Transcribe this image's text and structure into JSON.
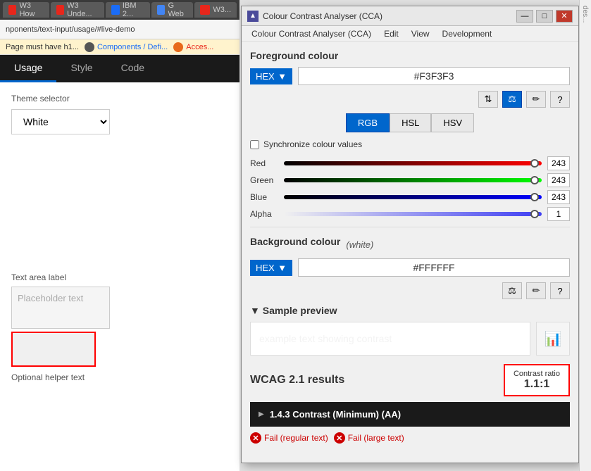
{
  "browser": {
    "tabs": [
      {
        "label": "W3 How",
        "active": false,
        "color": "#e8261b"
      },
      {
        "label": "W3 Unde...",
        "active": false,
        "color": "#e8261b"
      },
      {
        "label": "IBM 2...",
        "active": false,
        "color": "#1a6cf7"
      },
      {
        "label": "G Web",
        "active": false,
        "color": "#4285f4"
      },
      {
        "label": "W3...",
        "active": false,
        "color": "#e8261b"
      }
    ],
    "address": "nponents/text-input/usage/#live-demo",
    "alert": "Page must have h1...",
    "breadcrumb1": "Components / Defi...",
    "breadcrumb2": "Acces..."
  },
  "content_tabs": [
    {
      "label": "Usage",
      "active": true
    },
    {
      "label": "Style",
      "active": false
    },
    {
      "label": "Code",
      "active": false
    }
  ],
  "form": {
    "theme_label": "Theme selector",
    "theme_value": "White",
    "textarea_label": "Text area label",
    "placeholder": "Placeholder text",
    "helper": "Optional helper text"
  },
  "cca": {
    "title": "Colour Contrast Analyser (CCA)",
    "menu_items": [
      "Colour Contrast Analyser (CCA)",
      "Edit",
      "View",
      "Development"
    ],
    "fg_section": "Foreground colour",
    "fg_format": "HEX",
    "fg_value": "#F3F3F3",
    "color_modes": [
      "RGB",
      "HSL",
      "HSV"
    ],
    "active_mode": "RGB",
    "sync_label": "Synchronize colour values",
    "sliders": [
      {
        "label": "Red",
        "value": "243"
      },
      {
        "label": "Green",
        "value": "243"
      },
      {
        "label": "Blue",
        "value": "243"
      },
      {
        "label": "Alpha",
        "value": "1"
      }
    ],
    "bg_section": "Background colour",
    "bg_format": "HEX",
    "bg_value": "#FFFFFF",
    "bg_note": "(white)",
    "sample_preview": "▼ Sample preview",
    "sample_text": "example text showing contrast",
    "wcag_title": "WCAG 2.1 results",
    "contrast_ratio_label": "Contrast ratio",
    "contrast_ratio_value": "1.1:1",
    "wcag_item": "1.4.3 Contrast (Minimum) (AA)",
    "fail_regular": "Fail (regular text)",
    "fail_large": "Fail (large text)",
    "icons": {
      "sort": "⇅",
      "sliders": "⚖",
      "eyedropper": "✏",
      "help": "?"
    }
  }
}
